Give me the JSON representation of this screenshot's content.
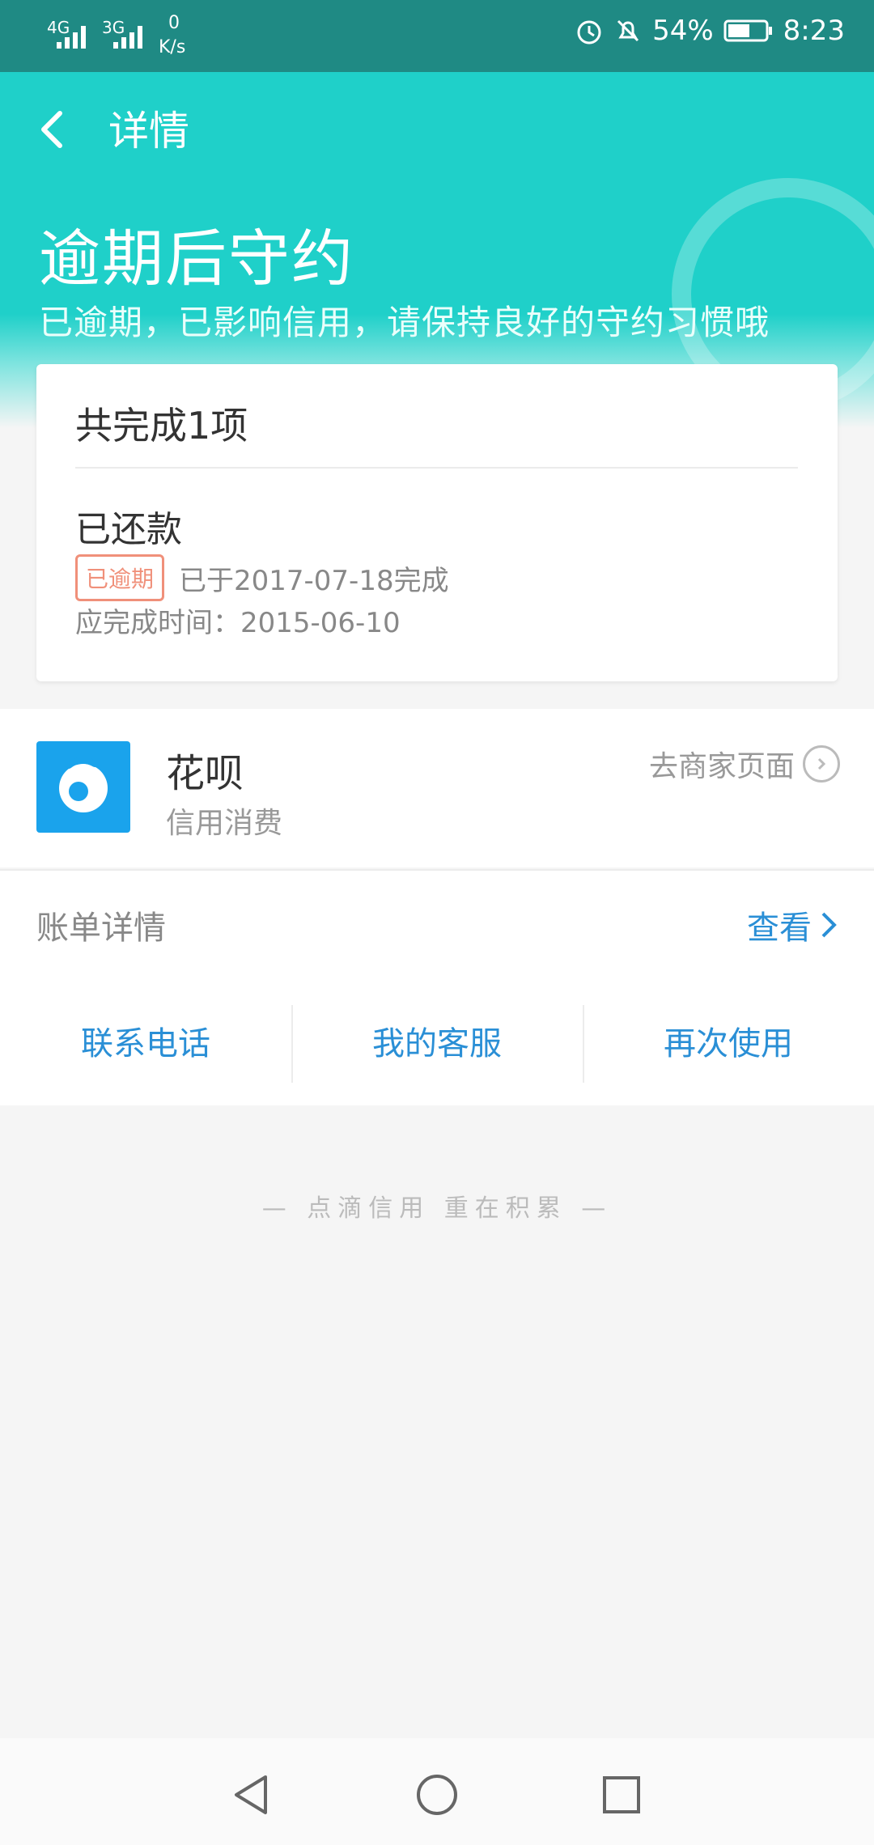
{
  "status_bar": {
    "signal1": "4G",
    "signal2": "3G",
    "net_speed_value": "0",
    "net_speed_unit": "K/s",
    "battery": "54%",
    "time": "8:23"
  },
  "header": {
    "back_icon": "chevron-left-icon",
    "nav_title": "详情",
    "hero_title": "逾期后守约",
    "hero_subtitle": "已逾期，已影响信用，请保持良好的守约习惯哦"
  },
  "card": {
    "summary": "共完成1项",
    "item_title": "已还款",
    "badge": "已逾期",
    "completed_text": "已于2017-07-18完成",
    "due_text": "应完成时间：2015-06-10"
  },
  "merchant": {
    "name": "花呗",
    "category": "信用消费",
    "link": "去商家页面"
  },
  "bill": {
    "label": "账单详情",
    "action": "查看"
  },
  "actions": [
    "联系电话",
    "我的客服",
    "再次使用"
  ],
  "slogan": "— 点滴信用  重在积累 —",
  "colors": {
    "accent": "#1fd0c9",
    "link": "#2a8fd6",
    "overdue": "#f0907a",
    "status_bar": "#1f8a84"
  }
}
